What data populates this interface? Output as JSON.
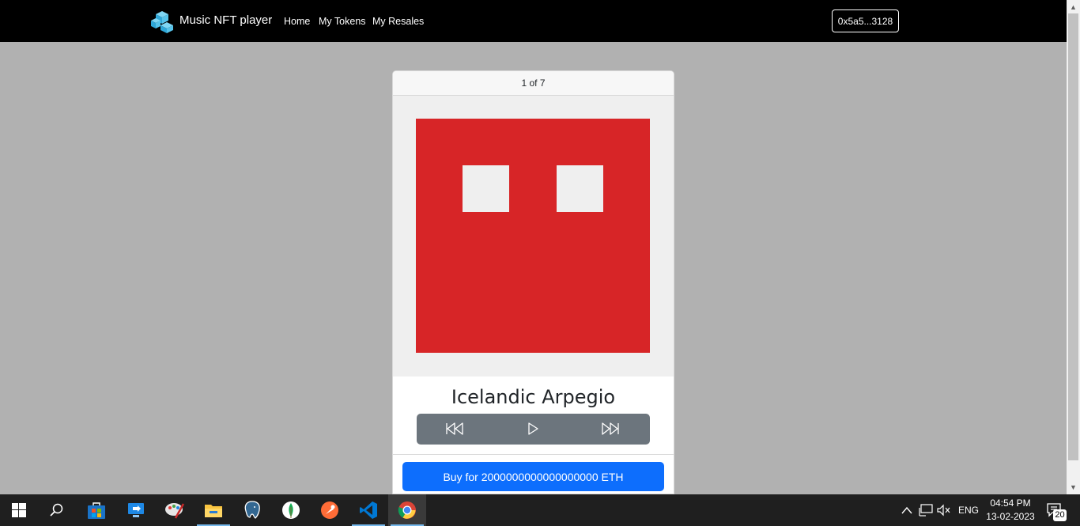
{
  "navbar": {
    "brand": "Music NFT player",
    "links": [
      "Home",
      "My Tokens",
      "My Resales"
    ],
    "wallet": "0x5a5...3128"
  },
  "card": {
    "pager": "1 of 7",
    "title": "Icelandic Arpegio",
    "buy_label": "Buy for 2000000000000000000 ETH",
    "art_color": "#d72527",
    "accent": "#0d6efd"
  },
  "taskbar": {
    "apps": [
      "windows-start",
      "search",
      "microsoft-store",
      "remote-desktop",
      "paint",
      "file-explorer",
      "postgresql",
      "mongodb",
      "postman",
      "vscode",
      "chrome"
    ],
    "lang": "ENG",
    "time": "04:54 PM",
    "date": "13-02-2023",
    "notifications": "20"
  }
}
